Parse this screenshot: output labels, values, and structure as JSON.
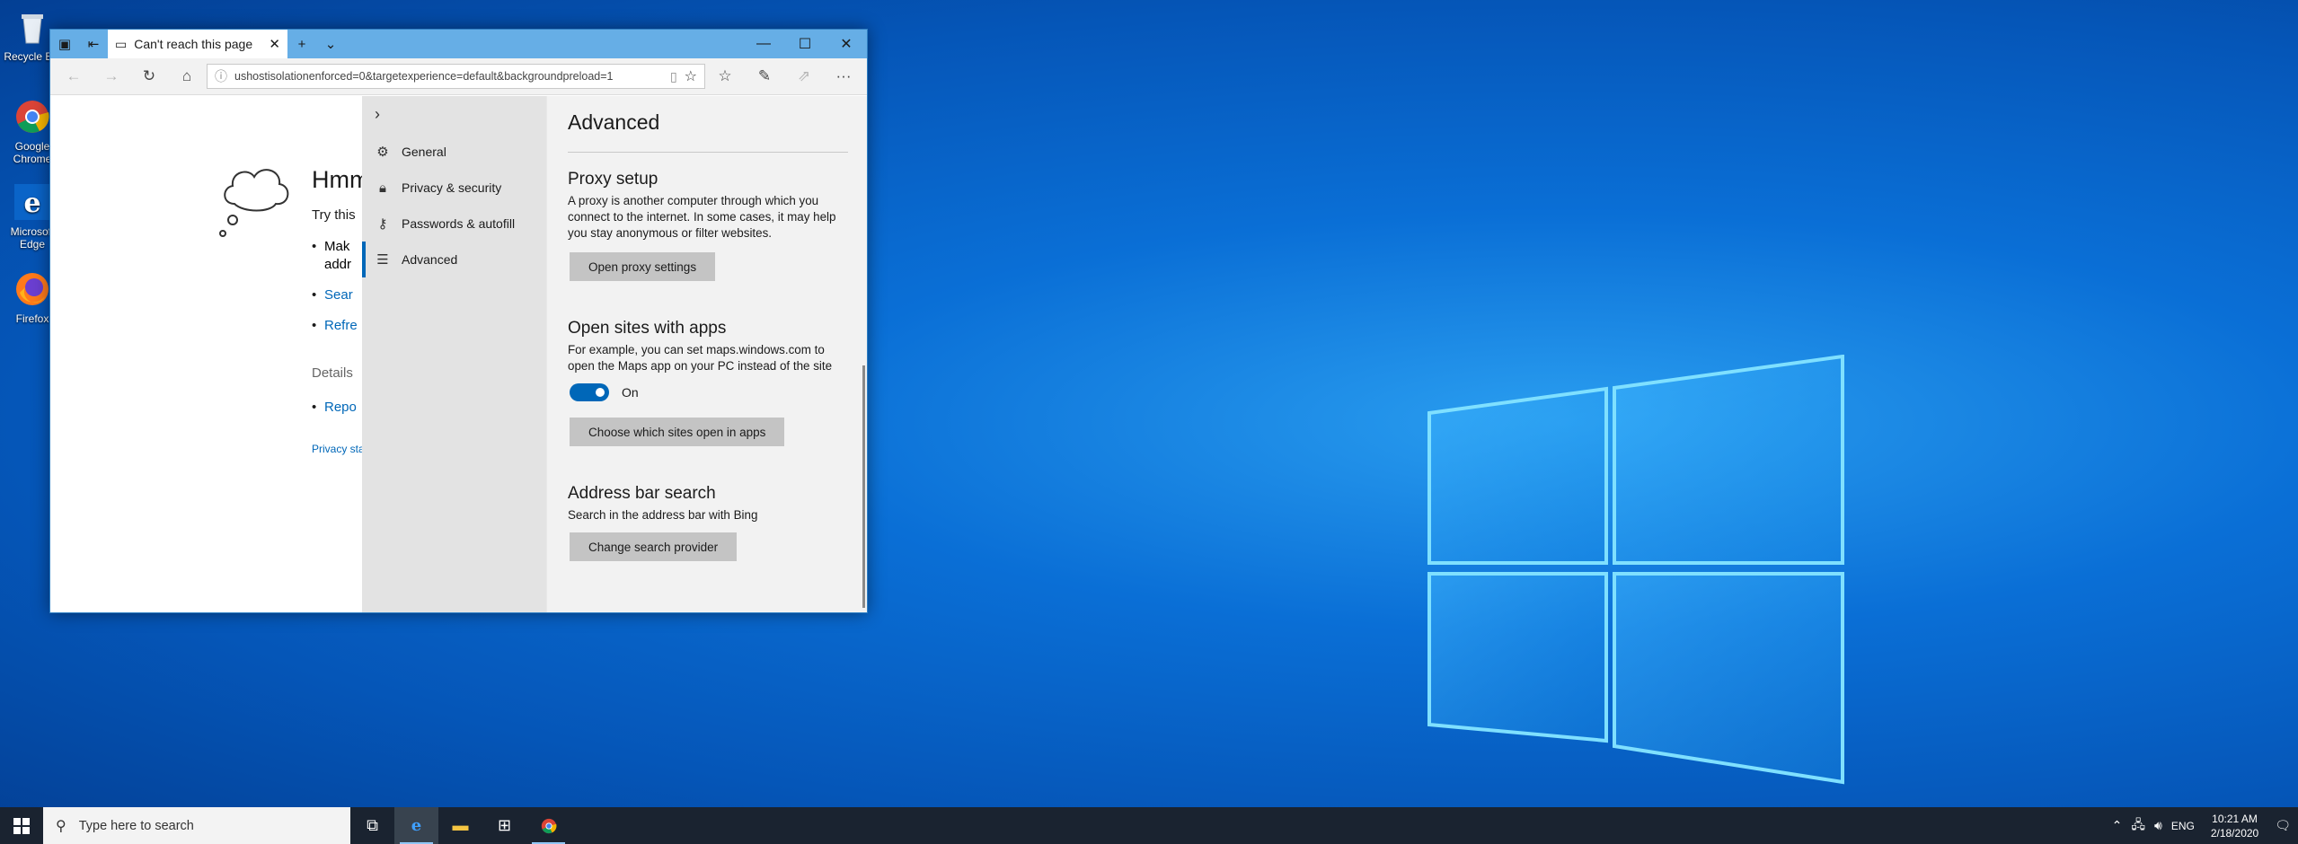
{
  "desktop": {
    "icons": [
      {
        "label": "Recycle Bin",
        "icon": "recycle-bin-icon"
      },
      {
        "label": "Google Chrome",
        "icon": "chrome-icon"
      },
      {
        "label": "Microsoft Edge",
        "icon": "edge-icon"
      },
      {
        "label": "Firefox",
        "icon": "firefox-icon"
      }
    ]
  },
  "browser": {
    "tab_title": "Can't reach this page",
    "url": "ushostisolationenforced=0&targetexperience=default&backgroundpreload=1"
  },
  "error_page": {
    "heading": "Hmm",
    "try_text": "Try this",
    "bullets": [
      "Mak",
      "Sear",
      "Refre"
    ],
    "bullet_line2": "addr",
    "details_label": "Details",
    "report_link": "Repo",
    "privacy_link": "Privacy sta"
  },
  "settings_nav": {
    "items": [
      {
        "label": "General",
        "icon": "gear-icon"
      },
      {
        "label": "Privacy & security",
        "icon": "lock-icon"
      },
      {
        "label": "Passwords & autofill",
        "icon": "key-icon"
      },
      {
        "label": "Advanced",
        "icon": "sliders-icon"
      }
    ]
  },
  "advanced": {
    "title": "Advanced",
    "proxy": {
      "title": "Proxy setup",
      "text": "A proxy is another computer through which you connect to the internet. In some cases, it may help you stay anonymous or filter websites.",
      "button": "Open proxy settings"
    },
    "apps": {
      "title": "Open sites with apps",
      "text": "For example, you can set maps.windows.com to open the Maps app on your PC instead of the site",
      "toggle_label": "On",
      "button": "Choose which sites open in apps"
    },
    "search": {
      "title": "Address bar search",
      "text": "Search in the address bar with Bing",
      "button": "Change search provider"
    }
  },
  "taskbar": {
    "search_placeholder": "Type here to search",
    "language": "ENG",
    "time": "10:21 AM",
    "date": "2/18/2020"
  },
  "colors": {
    "accent": "#0067b8",
    "titlebar": "#66aee6",
    "taskbar": "#1a2330"
  }
}
